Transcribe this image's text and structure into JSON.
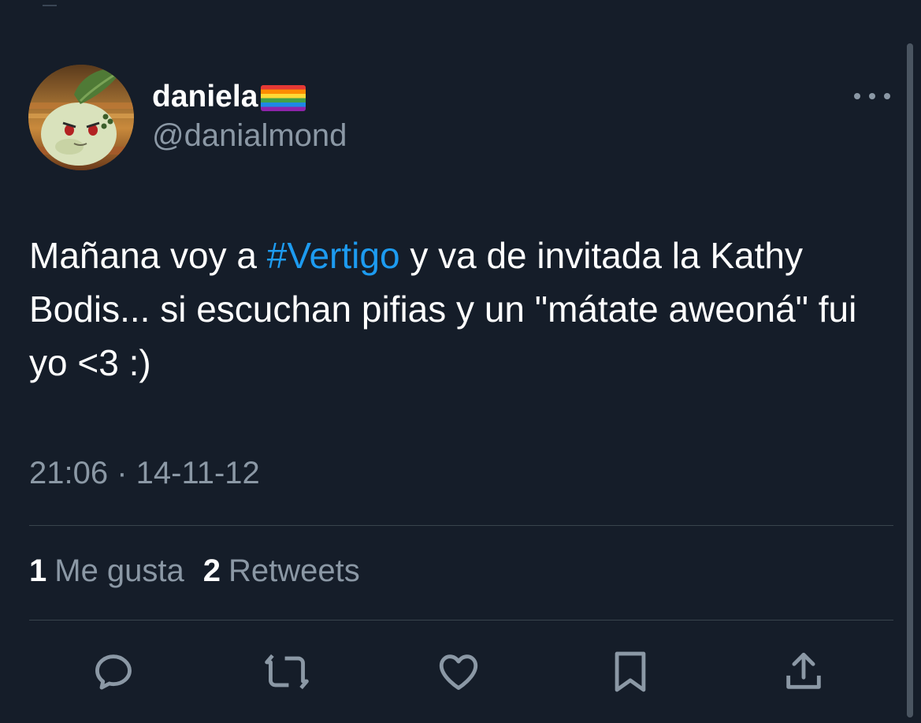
{
  "tweet": {
    "author": {
      "display_name": "daniela",
      "flag_icon": "rainbow-flag-icon",
      "handle": "@danialmond",
      "avatar_icon": "chikorita-avatar"
    },
    "more_icon": "more-dots-icon",
    "text": {
      "part1": "Mañana voy a ",
      "hashtag": "#Vertigo",
      "part2": " y va de invitada la Kathy Bodis... si escuchan pifias y un \"mátate aweoná\" fui yo <3 :)"
    },
    "timestamp": "21:06 · 14-11-12",
    "stats": {
      "likes_count": "1",
      "likes_label": "Me gusta",
      "retweets_count": "2",
      "retweets_label": "Retweets"
    },
    "actions": [
      {
        "name": "reply",
        "icon": "reply-icon"
      },
      {
        "name": "retweet",
        "icon": "retweet-icon"
      },
      {
        "name": "like",
        "icon": "heart-icon"
      },
      {
        "name": "bookmark",
        "icon": "bookmark-icon"
      },
      {
        "name": "share",
        "icon": "share-icon"
      }
    ]
  },
  "colors": {
    "background": "#151d29",
    "link": "#1d9bf0",
    "secondary_text": "#8b98a5",
    "divider": "#38444d"
  }
}
